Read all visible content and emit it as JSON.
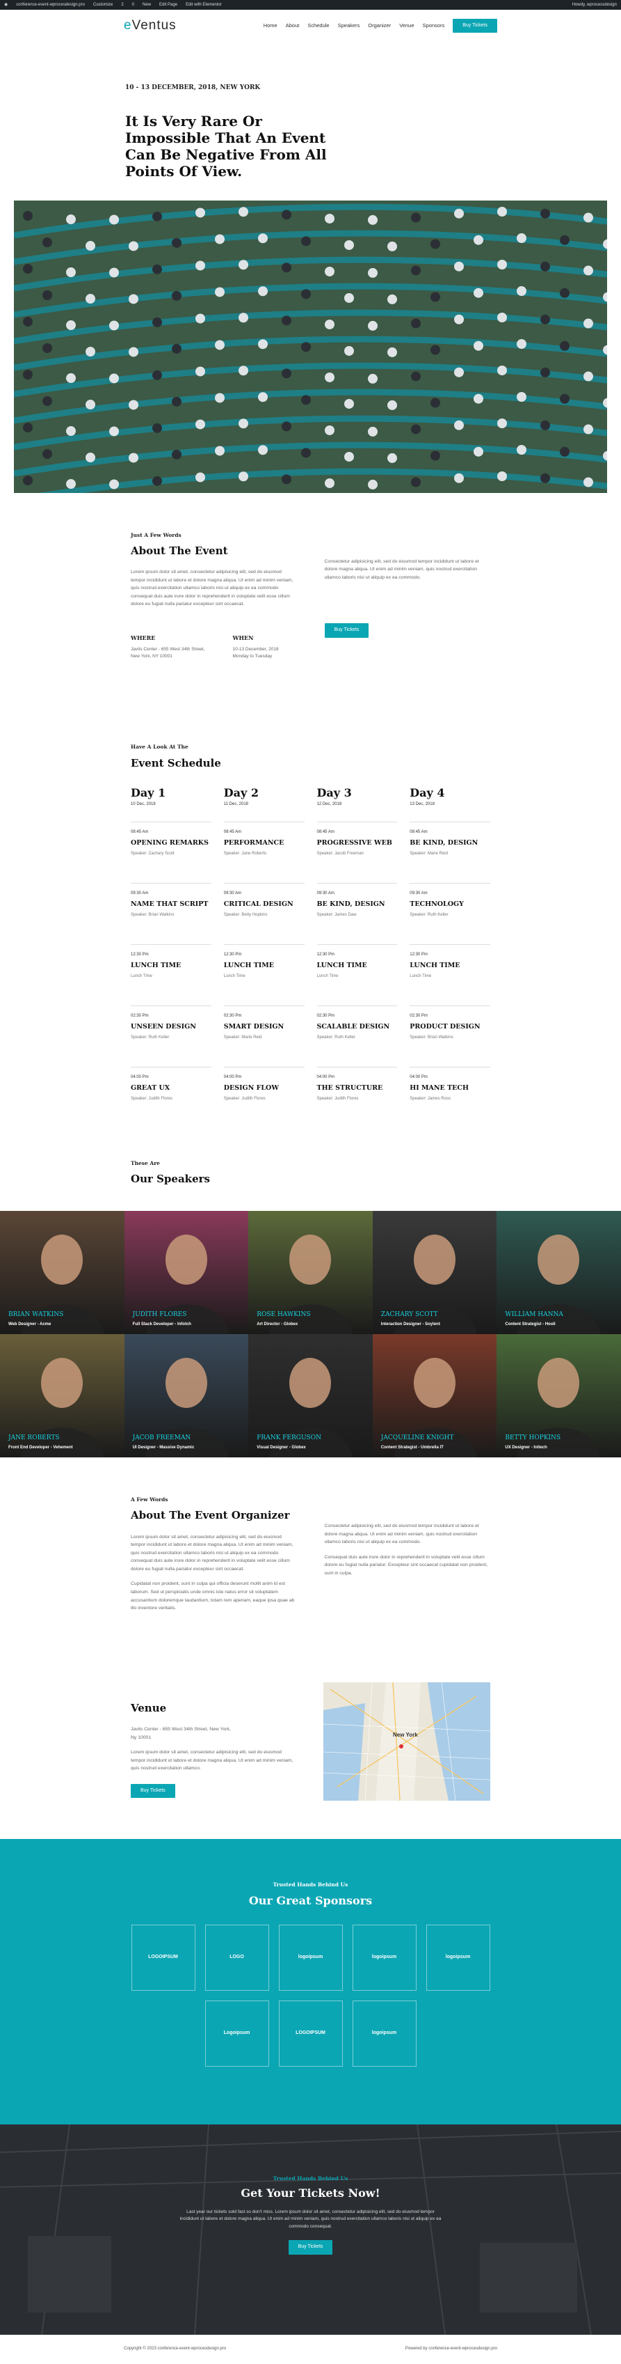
{
  "adminbar": {
    "items": [
      "conference-event-wprocesdesign.pro",
      "Customize",
      "2",
      "0",
      "New",
      "Edit Page",
      "Edit with Elementor"
    ],
    "right": "Howdy, wprocessdesign"
  },
  "header": {
    "logo_pre": "e",
    "logo_post": "Ventus",
    "nav": [
      "Home",
      "About",
      "Schedule",
      "Speakers",
      "Organizer",
      "Venue",
      "Sponsors"
    ],
    "cta": "Buy Tickets"
  },
  "hero": {
    "date": "10 - 13 DECEMBER, 2018, NEW YORK",
    "title": "It Is Very Rare Or Impossible That An Event Can Be Negative From All Points Of View."
  },
  "about": {
    "kicker": "Just A Few Words",
    "title": "About The Event",
    "text": "Lorem ipsum dolor sit amet, consectetur adipisicing elit, sed do eiusmod tempor incididunt ut labore et dolore magna aliqua. Ut enim ad minim veniam, quis nostrud exercitation ullamco laboris nisi ut aliquip ex ea commodo consequat duis aute irure dolor in reprehenderit in voluptate velit esse cillum dolore eu fugiat nulla pariatur excepteur sint occaecat.",
    "where_label": "WHERE",
    "where": [
      "Javits Center - 655 West 34th Street,",
      "New York, NY 10001"
    ],
    "when_label": "WHEN",
    "when": [
      "10-13 December, 2018",
      "Monday to Tuesday"
    ],
    "text2": "Consectetur adipisicing elit, sed do eiusmod tempor incididunt ut labore et dolore magna aliqua. Ut enim ad minim veniam, quis nostrud exercitation ullamco laboris nisi ut aliquip ex ea commodo.",
    "button": "Buy Tickets"
  },
  "schedule": {
    "kicker": "Have A Look At The",
    "title": "Event Schedule",
    "days": [
      {
        "name": "Day 1",
        "date": "10 Dec, 2018",
        "events": [
          [
            "08:45 Am",
            "OPENING REMARKS",
            "Speaker: Zachary Scott"
          ],
          [
            "09:30 Am",
            "NAME THAT SCRIPT",
            "Speaker: Brian Watkins"
          ],
          [
            "12:30 Pm",
            "LUNCH TIME",
            "Lunch Time"
          ],
          [
            "02:30 Pm",
            "UNSEEN DESIGN",
            "Speaker: Ruth Keller"
          ],
          [
            "04:00 Pm",
            "GREAT UX",
            "Speaker: Judith Flores"
          ]
        ]
      },
      {
        "name": "Day 2",
        "date": "11 Dec, 2018",
        "events": [
          [
            "08:45 Am",
            "PERFORMANCE",
            "Speaker: Jane Roberts"
          ],
          [
            "09:30 Am",
            "CRITICAL DESIGN",
            "Speaker: Betty Hopkins"
          ],
          [
            "12:30 Pm",
            "LUNCH TIME",
            "Lunch Time"
          ],
          [
            "02:30 Pm",
            "SMART DESIGN",
            "Speaker: Marie Reid"
          ],
          [
            "04:00 Pm",
            "DESIGN FLOW",
            "Speaker: Judith Flores"
          ]
        ]
      },
      {
        "name": "Day 3",
        "date": "12 Dec, 2018",
        "events": [
          [
            "08:45 Am",
            "PROGRESSIVE WEB",
            "Speaker: Jacob Freeman"
          ],
          [
            "09:30 Am",
            "BE KIND, DESIGN",
            "Speaker: James Daw"
          ],
          [
            "12:30 Pm",
            "LUNCH TIME",
            "Lunch Time"
          ],
          [
            "02:30 Pm",
            "SCALABLE DESIGN",
            "Speaker: Ruth Keller"
          ],
          [
            "04:00 Pm",
            "THE STRUCTURE",
            "Speaker: Judith Flores"
          ]
        ]
      },
      {
        "name": "Day 4",
        "date": "13 Dec, 2018",
        "events": [
          [
            "08:45 Am",
            "BE KIND, DESIGN",
            "Speaker: Marie Reid"
          ],
          [
            "09:30 Am",
            "TECHNOLOGY",
            "Speaker: Ruth Keller"
          ],
          [
            "12:30 Pm",
            "LUNCH TIME",
            "Lunch Time"
          ],
          [
            "02:30 Pm",
            "PRODUCT DESIGN",
            "Speaker: Brian Watkins"
          ],
          [
            "04:00 Pm",
            "HI MANE TECH",
            "Speaker: James Ross"
          ]
        ]
      }
    ]
  },
  "speakers": {
    "kicker": "These Are",
    "title": "Our Speakers",
    "list": [
      [
        "BRIAN WATKINS",
        "Web Designer - Acme",
        "#5a4636"
      ],
      [
        "JUDITH FLORES",
        "Full Stack Developer - Infotch",
        "#8a3a5a"
      ],
      [
        "ROSE HAWKINS",
        "Art Director - Globex",
        "#5c6a3a"
      ],
      [
        "ZACHARY SCOTT",
        "Interaction Designer - Soylent",
        "#3a3a3a"
      ],
      [
        "WILLIAM HANNA",
        "Content Strategist - Hooli",
        "#2f5a52"
      ],
      [
        "JANE ROBERTS",
        "Front End Developer - Vehement",
        "#6a5f3a"
      ],
      [
        "JACOB FREEMAN",
        "UI Designer - Massive Dynamic",
        "#3a4a5a"
      ],
      [
        "FRANK FERGUSON",
        "Visual Designer - Globex",
        "#2f2f2f"
      ],
      [
        "JACQUELINE KNIGHT",
        "Content Strategist - Umbrella IT",
        "#7a3a2a"
      ],
      [
        "BETTY HOPKINS",
        "UX Designer - Initech",
        "#4a6a3a"
      ]
    ]
  },
  "organizer": {
    "kicker": "A Few Words",
    "title": "About The Event Organizer",
    "p1": "Lorem ipsum dolor sit amet, consectetur adipisicing elit, sed do eiusmod tempor incididunt ut labore et dolore magna aliqua. Ut enim ad minim veniam, quis nostrud exercitation ullamco laboris nisi ut aliquip ex ea commodo consequat duis aute irure dolor in reprehenderit in voluptate velit esse cillum dolore eu fugiat nulla pariatur excepteur sint occaecat.",
    "p2": "Cupidatat non proident, sunt in culpa qui officia deserunt mollit anim id est laborum. Sed ut perspiciatis unde omnis iste natus error sit voluptatem accusantium doloremque laudantium, totam rem aperiam, eaque ipsa quae ab illo inventore veritatis.",
    "p3": "Consectetur adipisicing elit, sed do eiusmod tempor incididunt ut labore et dolore magna aliqua. Ut enim ad minim veniam, quis nostrud exercitation ullamco laboris nisi ut aliquip ex ea commodo.",
    "p4": "Consequat duis aute irure dolor in reprehenderit in voluptate velit esse cillum dolore eu fugiat nulla pariatur. Excepteur sint occaecat cupidatat non proident, sunt in culpa."
  },
  "venue": {
    "title": "Venue",
    "addr": [
      "Javits Center - 655 West 34th Street, New York,",
      "Ny 10001"
    ],
    "text": "Lorem ipsum dolor sit amet, consectetur adipisicing elit, sed do eiusmod tempor incididunt ut labore et dolore magna aliqua. Ut enim ad minim veniam, quis nostrud exercitation ullamco.",
    "button": "Buy Tickets",
    "map_label": "New York"
  },
  "sponsors": {
    "kicker": "Trusted Hands Behind Us",
    "title": "Our Great Sponsors",
    "logos": [
      "LOGOIPSUM",
      "LOGO",
      "logoipsum",
      "logoipsum",
      "logoipsum",
      "Logoipsum",
      "LOGOIPSUM",
      "logoipsum"
    ]
  },
  "cta": {
    "kicker": "Trusted Hands Behind Us",
    "title": "Get Your Tickets Now!",
    "text": "Last year our tickets sold fast so don't miss. Lorem ipsum dolor sit amet, consectetur adipisicing elit, sed do eiusmod tempor incididunt ut labore et dolore magna aliqua. Ut enim ad minim veniam, quis nostrud exercitation ullamco laboris nisi ut aliquip ex ea commodo consequat.",
    "button": "Buy Tickets"
  },
  "footer": {
    "left": "Copyright © 2023 conference-event-wprocesdesign.pro",
    "right": "Powered by conference-event-wprocesdesign.pro"
  }
}
